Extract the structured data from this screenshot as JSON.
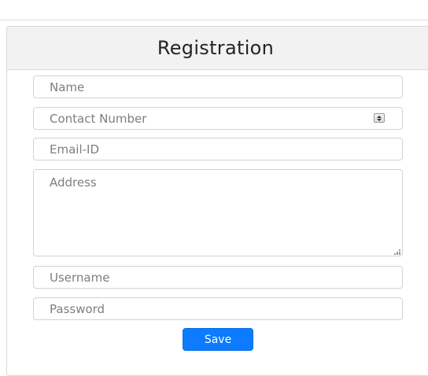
{
  "form": {
    "title": "Registration",
    "fields": {
      "name": {
        "placeholder": "Name",
        "value": ""
      },
      "contact_number": {
        "placeholder": "Contact Number",
        "value": ""
      },
      "email": {
        "placeholder": "Email-ID",
        "value": ""
      },
      "address": {
        "placeholder": "Address",
        "value": ""
      },
      "username": {
        "placeholder": "Username",
        "value": ""
      },
      "password": {
        "placeholder": "Password",
        "value": ""
      }
    },
    "save_label": "Save"
  },
  "colors": {
    "primary_button": "#0d7bff",
    "header_background": "#f2f2f2",
    "border": "#ced4da"
  },
  "icons": {
    "number_spinner": "spinner-arrows-icon",
    "resize_handle": "resize-grip-icon"
  }
}
